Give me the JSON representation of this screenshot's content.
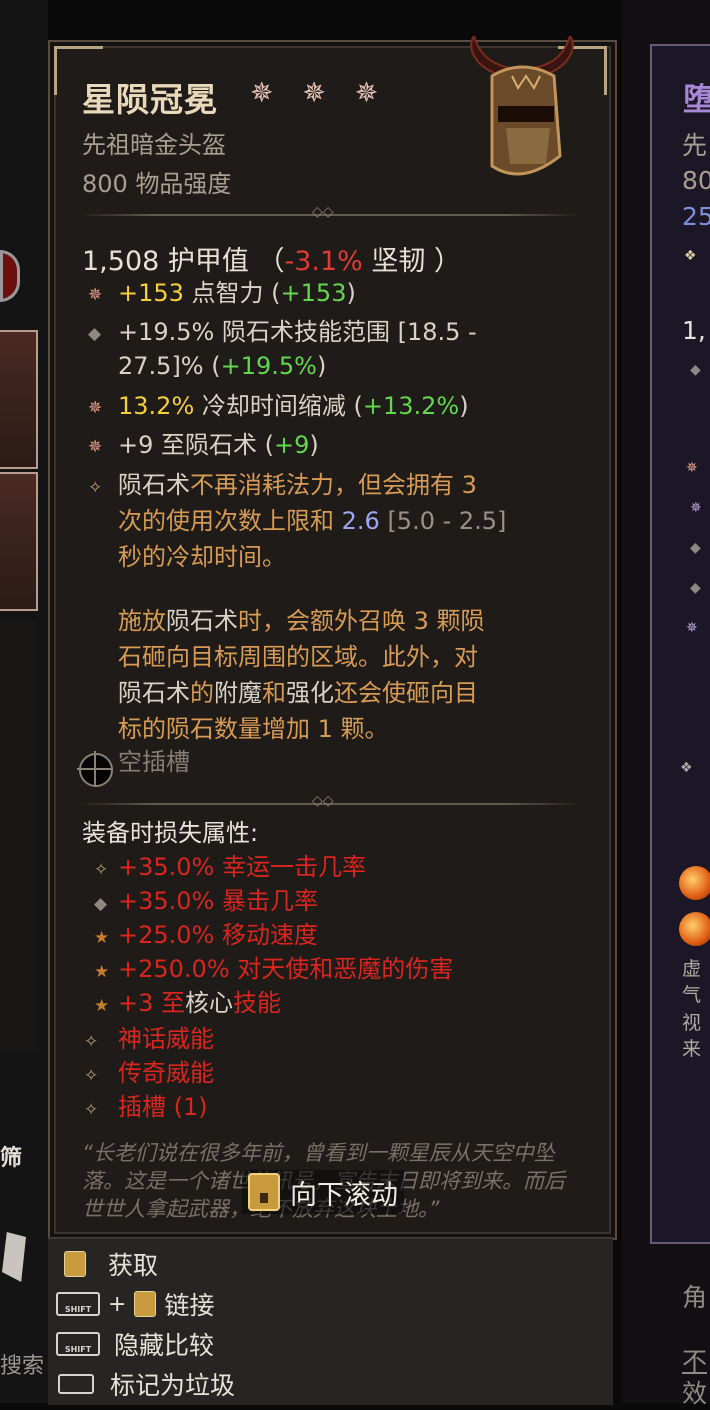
{
  "item": {
    "name": "星陨冠冕",
    "stars": "✵ ✵ ✵",
    "type": "先祖暗金头盔",
    "power": "800 物品强度",
    "armor_value": "1,508 护甲值 （",
    "armor_delta": "-3.1%",
    "armor_suffix": "坚韧 ）"
  },
  "affixes": [
    {
      "prefix": "+153",
      "label": " 点智力 (",
      "delta": "+153",
      "close": ")"
    },
    {
      "text1": "+19.5% 陨石术技能范围 [18.5 -",
      "text2_a": "27.5]% (",
      "delta": "+19.5%",
      "close": ")"
    },
    {
      "prefix": "13.2%",
      "label": " 冷却时间缩减 (",
      "delta": "+13.2%",
      "close": ")"
    },
    {
      "label": "+9 至陨石术 (",
      "delta": "+9",
      "close": ")"
    }
  ],
  "aspect": {
    "p1_a": "陨石术",
    "p1_b": "不再消耗法力，但会拥有 3",
    "p1_c": "次的使用次数上限和 ",
    "p1_val": "2.6",
    "p1_range": " [5.0 - 2.5]",
    "p1_d": "秒的冷却时间。",
    "p2_a": "施放",
    "p2_b": "陨石术",
    "p2_c": "时，会额外召唤 3 颗陨",
    "p2_d": "石砸向目标周围的区域。此外，对",
    "p2_e": "陨石术",
    "p2_f": "的",
    "p2_g": "附魔",
    "p2_h": "和",
    "p2_i": "强化",
    "p2_j": "还会使砸向目",
    "p2_k": "标的陨石数量增加 1 颗。"
  },
  "socket_label": "空插槽",
  "lost_header": "装备时损失属性:",
  "lost": [
    "+35.0% 幸运一击几率",
    "+35.0% 暴击几率",
    "+25.0% 移动速度",
    "+250.0% 对天使和恶魔的伤害",
    {
      "a": "+3 至",
      "b": "核心",
      "c": "技能"
    },
    "神话威能",
    "传奇威能",
    "插槽 (1)"
  ],
  "flavor": "“长老们说在很多年前，曾看到一颗星辰从天空中坠落。这是一个诸世的讯号，宣告末日即将到来。而后世世人拿起武器，绝不放弃这块土地。”",
  "scroll_hint": "向下滚动",
  "commands": {
    "acquire": "获取",
    "link": "链接",
    "hide_compare": "隐藏比较",
    "mark_junk": "标记为垃圾",
    "shift_key": "SHIFT",
    "plus": "+"
  },
  "left_bg": {
    "filter": "筛",
    "search": "搜索"
  },
  "right_bg": {
    "title_char": "堕",
    "lines": [
      "先",
      "80",
      "25",
      "1,"
    ],
    "desc": [
      "虚",
      "气",
      "视",
      "来"
    ],
    "bottom": [
      "角",
      "不",
      "效"
    ]
  },
  "colors": {
    "yellow": "#f6cf3a",
    "green": "#64d64e",
    "orange": "#d79b55",
    "red": "#d8261f",
    "blue": "#9ba7f2"
  }
}
